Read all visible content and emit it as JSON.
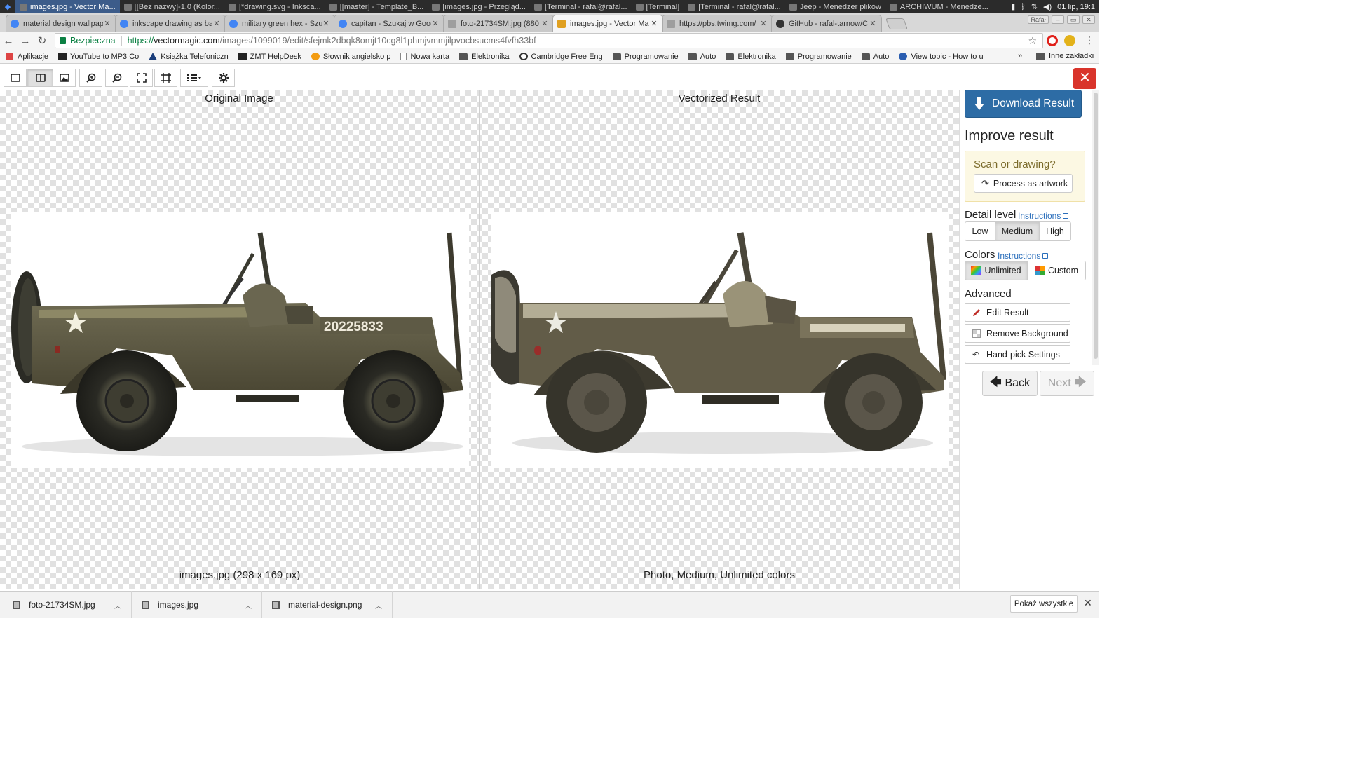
{
  "os": {
    "tasks": [
      {
        "label": "images.jpg - Vector Ma...",
        "active": true
      },
      {
        "label": "[[Bez nazwy]-1.0 (Kolor...",
        "active": false
      },
      {
        "label": "[*drawing.svg - Inksca...",
        "active": false
      },
      {
        "label": "[[master] - Template_B...",
        "active": false
      },
      {
        "label": "[images.jpg - Przegląd...",
        "active": false
      },
      {
        "label": "[Terminal - rafal@rafal...",
        "active": false
      },
      {
        "label": "[Terminal]",
        "active": false
      },
      {
        "label": "[Terminal - rafal@rafal...",
        "active": false
      },
      {
        "label": "Jeep - Menedżer plików",
        "active": false
      },
      {
        "label": "ARCHIWUM - Menedże...",
        "active": false
      }
    ],
    "clock": "01 lip, 19:1"
  },
  "tabs": [
    {
      "title": "material design wallpap",
      "icon": "google-icon"
    },
    {
      "title": "inkscape drawing as ba",
      "icon": "google-icon"
    },
    {
      "title": "military green hex - Szu",
      "icon": "google-icon"
    },
    {
      "title": "capitan - Szukaj w Goog",
      "icon": "google-icon"
    },
    {
      "title": "foto-21734SM.jpg (880",
      "icon": "doc-icon"
    },
    {
      "title": "images.jpg - Vector Ma",
      "icon": "vectormagic-icon",
      "active": true
    },
    {
      "title": "https://pbs.twimg.com/",
      "icon": "doc-icon"
    },
    {
      "title": "GitHub - rafal-tarnow/C",
      "icon": "github-icon"
    }
  ],
  "window": {
    "user_badge": "Rafał"
  },
  "address": {
    "secure_label": "Bezpieczna",
    "scheme": "https://",
    "host": "vectormagic.com",
    "path": "/images/1099019/edit/sfejmk2dbqk8omjt10cg8l1phmjvmmjilpvocbsucms4fvfh33bf"
  },
  "bookmarks": [
    {
      "label": "Aplikacje",
      "icon": "apps-icon"
    },
    {
      "label": "YouTube to MP3 Co",
      "icon": "youtube-icon"
    },
    {
      "label": "Książka Telefoniczn",
      "icon": "triangle-icon"
    },
    {
      "label": "ZMT HelpDesk",
      "icon": "zmt-icon"
    },
    {
      "label": "Słownik angielsko p",
      "icon": "dictionary-icon"
    },
    {
      "label": "Nowa karta",
      "icon": "page-icon"
    },
    {
      "label": "Elektronika",
      "icon": "folder-icon"
    },
    {
      "label": "Cambridge Free Eng",
      "icon": "cambridge-icon"
    },
    {
      "label": "Programowanie",
      "icon": "folder-icon"
    },
    {
      "label": "Auto",
      "icon": "folder-icon"
    },
    {
      "label": "Elektronika",
      "icon": "folder-icon"
    },
    {
      "label": "Programowanie",
      "icon": "folder-icon"
    },
    {
      "label": "Auto",
      "icon": "folder-icon"
    },
    {
      "label": "View topic - How to u",
      "icon": "viewtopic-icon"
    }
  ],
  "bookmarks_more": "»",
  "bookmarks_other": "Inne zakładki",
  "viewer": {
    "left_title": "Original Image",
    "right_title": "Vectorized Result",
    "left_caption": "images.jpg (298 x 169 px)",
    "right_caption": "Photo, Medium, Unlimited colors",
    "plate_text": "20225833"
  },
  "panel": {
    "download_label": "Download Result",
    "improve_heading": "Improve result",
    "scan_question": "Scan or drawing?",
    "process_artwork": "Process as artwork",
    "detail_heading": "Detail level",
    "instructions": "Instructions",
    "detail_options": [
      "Low",
      "Medium",
      "High"
    ],
    "detail_selected": "Medium",
    "colors_heading": "Colors",
    "color_options": [
      "Unlimited",
      "Custom"
    ],
    "color_selected": "Unlimited",
    "advanced_heading": "Advanced",
    "advanced_buttons": [
      "Edit Result",
      "Remove Background",
      "Hand-pick Settings"
    ],
    "back_label": "Back",
    "next_label": "Next"
  },
  "downloads": {
    "items": [
      "foto-21734SM.jpg",
      "images.jpg",
      "material-design.png"
    ],
    "show_all": "Pokaż wszystkie"
  },
  "colors": {
    "accent": "#2d6ca5",
    "close_red": "#d9342b",
    "scan_bg": "#fcf8e3",
    "jeep_green": "#5b5640"
  }
}
